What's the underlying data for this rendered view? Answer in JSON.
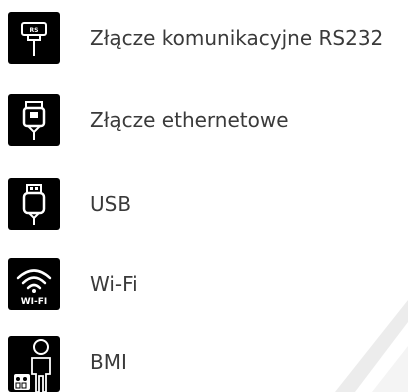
{
  "items": [
    {
      "label": "Złącze komunikacyjne RS232",
      "icon": "rs232-connector-icon"
    },
    {
      "label": "Złącze ethernetowe",
      "icon": "ethernet-connector-icon"
    },
    {
      "label": "USB",
      "icon": "usb-connector-icon"
    },
    {
      "label": "Wi-Fi",
      "icon": "wifi-icon",
      "icon_text": "WI-FI"
    },
    {
      "label": "BMI",
      "icon": "bmi-person-icon"
    }
  ],
  "colors": {
    "icon_background": "#000000",
    "icon_foreground": "#ffffff",
    "label_text": "#3a3a3a"
  }
}
